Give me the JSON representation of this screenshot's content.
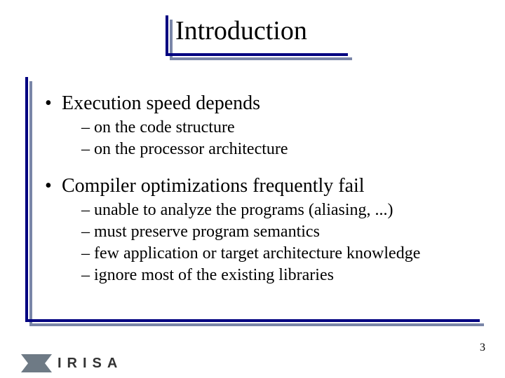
{
  "title": "Introduction",
  "bullets": [
    {
      "text": "Execution speed depends",
      "subs": [
        "on the code structure",
        "on the processor architecture"
      ]
    },
    {
      "text": "Compiler optimizations frequently fail",
      "subs": [
        "unable to analyze the programs (aliasing, ...)",
        "must preserve program semantics",
        "few application or target architecture knowledge",
        "ignore most of the existing libraries"
      ]
    }
  ],
  "page_number": "3",
  "logo_text": "IRISA"
}
